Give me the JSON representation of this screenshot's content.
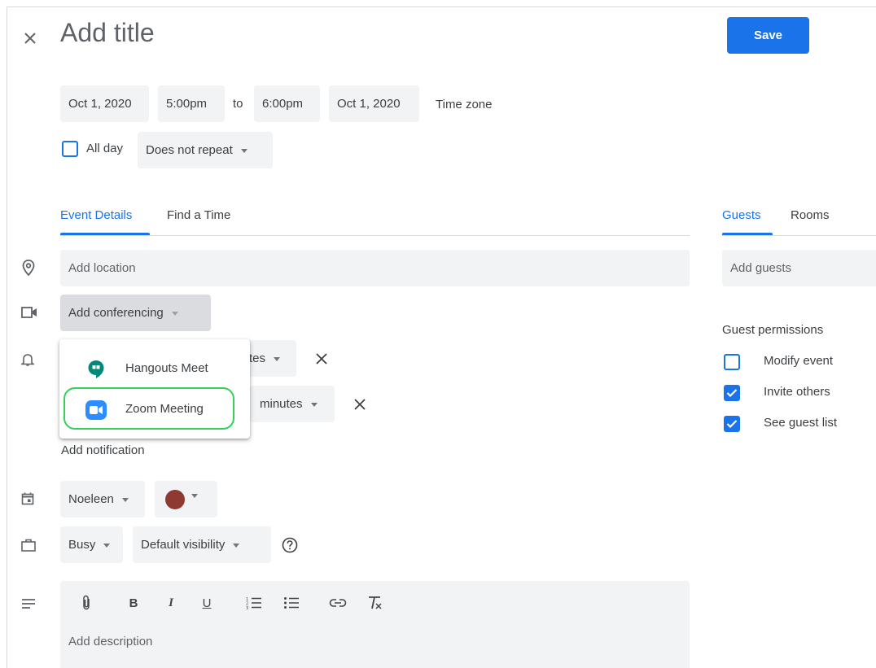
{
  "header": {
    "close_icon": "close-icon",
    "title_placeholder": "Add title",
    "save_label": "Save"
  },
  "datetime": {
    "start_date": "Oct 1, 2020",
    "start_time": "5:00pm",
    "to_label": "to",
    "end_time": "6:00pm",
    "end_date": "Oct 1, 2020",
    "timezone_label": "Time zone"
  },
  "allday": {
    "label": "All day",
    "checked": false,
    "repeat_value": "Does not repeat"
  },
  "tabs": {
    "left": [
      {
        "label": "Event Details",
        "active": true
      },
      {
        "label": "Find a Time",
        "active": false
      }
    ],
    "right": [
      {
        "label": "Guests",
        "active": true
      },
      {
        "label": "Rooms",
        "active": false
      }
    ]
  },
  "details": {
    "location_placeholder": "Add location",
    "conferencing_label": "Add conferencing",
    "notification1_unit_partial": "tes",
    "notification2_unit": "minutes",
    "add_notification": "Add notification",
    "calendar_owner": "Noeleen",
    "event_color": "#8e3a32",
    "busy_value": "Busy",
    "visibility_value": "Default visibility",
    "description_placeholder": "Add description"
  },
  "conferencing_menu": {
    "items": [
      {
        "label": "Hangouts Meet",
        "icon": "hangouts-meet-icon",
        "color": "#00897b"
      },
      {
        "label": "Zoom Meeting",
        "icon": "zoom-icon",
        "color": "#2d8cff",
        "highlighted": true
      }
    ]
  },
  "toolbar": {
    "buttons": [
      "attachment-icon",
      "bold-icon",
      "italic-icon",
      "underline-icon",
      "numbered-list-icon",
      "bulleted-list-icon",
      "link-icon",
      "clear-formatting-icon"
    ],
    "bold_glyph": "B",
    "italic_glyph": "I",
    "underline_glyph": "U"
  },
  "guests": {
    "placeholder": "Add guests",
    "permissions_title": "Guest permissions",
    "permissions": [
      {
        "label": "Modify event",
        "checked": false
      },
      {
        "label": "Invite others",
        "checked": true
      },
      {
        "label": "See guest list",
        "checked": true
      }
    ]
  },
  "colors": {
    "accent": "#1a73e8",
    "highlight_ring": "#34d058"
  }
}
